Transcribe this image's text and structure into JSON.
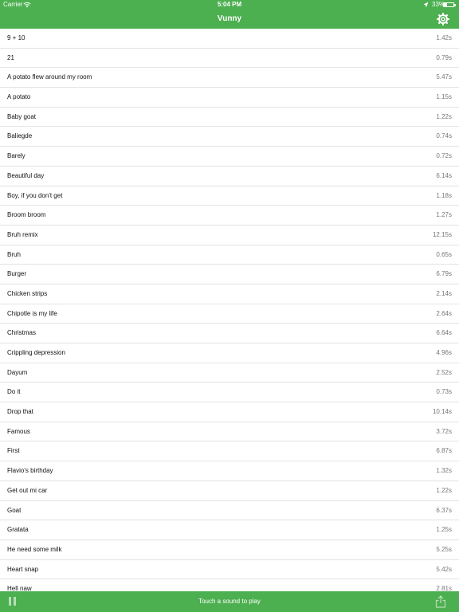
{
  "status_bar": {
    "carrier": "Carrier",
    "time": "5:04 PM",
    "battery": "33%",
    "battery_level": 0.33
  },
  "nav": {
    "title": "Vunny",
    "settings_icon": "gear-icon"
  },
  "sounds": [
    {
      "name": "9 + 10",
      "duration": "1.42s"
    },
    {
      "name": "21",
      "duration": "0.79s"
    },
    {
      "name": "A potato flew around my room",
      "duration": "5.47s"
    },
    {
      "name": "A potato",
      "duration": "1.15s"
    },
    {
      "name": "Baby goat",
      "duration": "1.22s"
    },
    {
      "name": "Baliegde",
      "duration": "0.74s"
    },
    {
      "name": "Barely",
      "duration": "0.72s"
    },
    {
      "name": "Beautiful day",
      "duration": "6.14s"
    },
    {
      "name": "Boy, if you don't get",
      "duration": "1.18s"
    },
    {
      "name": "Broom broom",
      "duration": "1.27s"
    },
    {
      "name": "Bruh remix",
      "duration": "12.15s"
    },
    {
      "name": "Bruh",
      "duration": "0.65s"
    },
    {
      "name": "Burger",
      "duration": "6.79s"
    },
    {
      "name": "Chicken strips",
      "duration": "2.14s"
    },
    {
      "name": "Chipotle is my life",
      "duration": "2.64s"
    },
    {
      "name": "Christmas",
      "duration": "6.64s"
    },
    {
      "name": "Crippling depression",
      "duration": "4.96s"
    },
    {
      "name": "Dayum",
      "duration": "2.52s"
    },
    {
      "name": "Do it",
      "duration": "0.73s"
    },
    {
      "name": "Drop that",
      "duration": "10.14s"
    },
    {
      "name": "Famous",
      "duration": "3.72s"
    },
    {
      "name": "First",
      "duration": "6.87s"
    },
    {
      "name": "Flavio's birthday",
      "duration": "1.32s"
    },
    {
      "name": "Get out mi car",
      "duration": "1.22s"
    },
    {
      "name": "Goat",
      "duration": "6.37s"
    },
    {
      "name": "Gratata",
      "duration": "1.25s"
    },
    {
      "name": "He need some milk",
      "duration": "5.25s"
    },
    {
      "name": "Heart snap",
      "duration": "5.42s"
    },
    {
      "name": "Hell naw",
      "duration": "2.81s"
    }
  ],
  "bottom_bar": {
    "hint": "Touch a sound to play",
    "pause_icon": "pause-icon",
    "share_icon": "share-icon"
  },
  "colors": {
    "accent": "#4caf50"
  }
}
